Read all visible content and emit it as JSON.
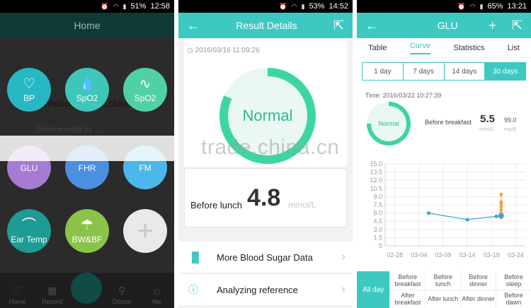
{
  "screen1": {
    "status": {
      "battery": "51%",
      "time": "12:58"
    },
    "title": "Home",
    "welcome": "Welcome to ....cloud",
    "subtitle": "Become ready for ...",
    "buttons": [
      {
        "name": "bp",
        "label": "BP",
        "glyph": "♡",
        "color": "#27b8c4"
      },
      {
        "name": "spo2-a",
        "label": "SpO2",
        "glyph": "💧",
        "color": "#3ec6b8"
      },
      {
        "name": "spo2-b",
        "label": "SpO2",
        "glyph": "∿",
        "color": "#4fd1a4"
      },
      {
        "name": "glu",
        "label": "GLU",
        "glyph": "",
        "color": "#a77bd3"
      },
      {
        "name": "fhr",
        "label": "FHR",
        "glyph": "",
        "color": "#4a8fe0"
      },
      {
        "name": "fm",
        "label": "FM",
        "glyph": "",
        "color": "#4cb7ea"
      },
      {
        "name": "ear-temp",
        "label": "Ear Temp",
        "glyph": "⌒",
        "color": "#1e9b94"
      },
      {
        "name": "bw-bf",
        "label": "BW&BF",
        "glyph": "☂",
        "color": "#8bc34a"
      },
      {
        "name": "add",
        "label": "+",
        "glyph": "",
        "color": "#e9e9e9"
      }
    ],
    "nav": [
      "Home",
      "Record",
      "Doctor",
      "Me"
    ]
  },
  "screen2": {
    "status": {
      "battery": "53%",
      "time": "14:52"
    },
    "title": "Result Details",
    "datetime": "2016/03/16  11:09:26",
    "result": "Normal",
    "reading_label": "Before lunch",
    "reading_value": "4.8",
    "reading_unit": "mmol/L",
    "rows": [
      {
        "label": "More Blood Sugar Data",
        "icon": "bar-chart-icon"
      },
      {
        "label": "Analyzing reference",
        "icon": "info-icon"
      }
    ]
  },
  "screen3": {
    "status": {
      "battery": "65%",
      "time": "13:21"
    },
    "title": "GLU",
    "tabs": [
      "Table",
      "Curve",
      "Statistics",
      "List"
    ],
    "active_tab": "Curve",
    "ranges": [
      "1 day",
      "7 days",
      "14 days",
      "30 days"
    ],
    "active_range": "30 days",
    "time": "Time: 2016/03/22  10:27:39",
    "status_text": "Normal",
    "meal": "Before breakfast",
    "value": "5.5",
    "unit": "mmol/L",
    "value2": "99.0",
    "unit2": "mg/dl",
    "filters_all": "All day",
    "filters": [
      [
        "Before breakfast",
        "After breakfast"
      ],
      [
        "Before lunch",
        "After lunch"
      ],
      [
        "Before dinner",
        "After dinner"
      ],
      [
        "Before sleep",
        "Before dawn"
      ]
    ]
  },
  "watermark": "trade.china.cn",
  "chart_data": {
    "type": "line",
    "x": [
      "02-28",
      "03-04",
      "03-09",
      "03-14",
      "03-19",
      "03-24"
    ],
    "ylim": [
      0,
      15
    ],
    "yticks": [
      0,
      1.5,
      3.0,
      4.5,
      6.0,
      7.5,
      9.0,
      10.5,
      12.0,
      13.5,
      15.0
    ],
    "series": [
      {
        "points": [
          [
            "03-06",
            6.0
          ],
          [
            "03-14",
            4.8
          ],
          [
            "03-20",
            5.4
          ],
          [
            "03-21",
            5.5
          ]
        ],
        "color": "#3aa7d8"
      },
      {
        "points": [
          [
            "03-21",
            5.2
          ],
          [
            "03-21",
            5.6
          ],
          [
            "03-21",
            6.0
          ],
          [
            "03-21",
            6.6
          ],
          [
            "03-21",
            7.2
          ],
          [
            "03-21",
            7.8
          ],
          [
            "03-21",
            8.0
          ],
          [
            "03-21",
            9.4
          ]
        ],
        "color": "#f0a040"
      }
    ],
    "grid": true
  }
}
